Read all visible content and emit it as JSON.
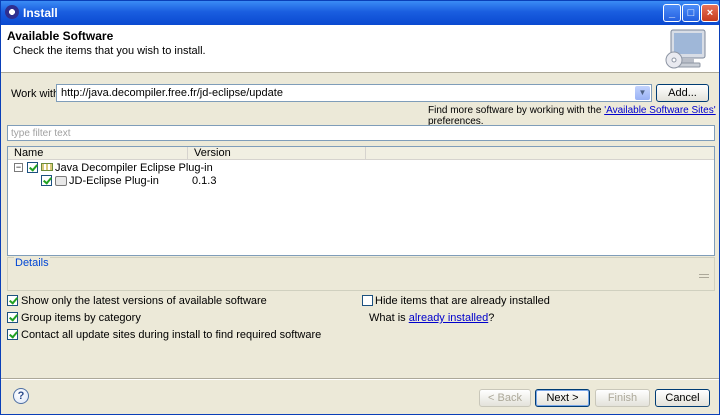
{
  "window": {
    "title": "Install"
  },
  "title_buttons": {
    "minimize": "_",
    "maximize": "□",
    "close": "×"
  },
  "header": {
    "title": "Available Software",
    "subtitle": "Check the items that you wish to install.",
    "icon": "install-monitor-icon"
  },
  "work_with": {
    "label": "Work with:",
    "value": "http://java.decompiler.free.fr/jd-eclipse/update",
    "dropdown_icon": "▼",
    "add_button": "Add..."
  },
  "find_more": {
    "prefix": "Find more software by working with the ",
    "link": "'Available Software Sites'",
    "suffix": " preferences."
  },
  "filter": {
    "placeholder": "type filter text"
  },
  "tree": {
    "columns": [
      "Name",
      "Version"
    ],
    "rows": [
      {
        "label": "Java Decompiler Eclipse Plug-in",
        "version": "",
        "checked": true,
        "expanded": true,
        "expander": "−",
        "icon": "category-icon"
      },
      {
        "label": "JD-Eclipse Plug-in",
        "version": "0.1.3",
        "checked": true,
        "icon": "plugin-icon"
      }
    ]
  },
  "details": {
    "label": "Details"
  },
  "options": {
    "latest_versions": {
      "label": "Show only the latest versions of available software",
      "checked": true
    },
    "hide_installed": {
      "label": "Hide items that are already installed",
      "checked": false
    },
    "group_by_category": {
      "label": "Group items by category",
      "checked": true
    },
    "what_is_prefix": "What is ",
    "already_installed_link": "already installed",
    "what_is_suffix": "?",
    "contact_update_sites": {
      "label": "Contact all update sites during install to find required software",
      "checked": true
    }
  },
  "footer": {
    "help_icon": "?",
    "back": "< Back",
    "next": "Next >",
    "finish": "Finish",
    "cancel": "Cancel"
  }
}
